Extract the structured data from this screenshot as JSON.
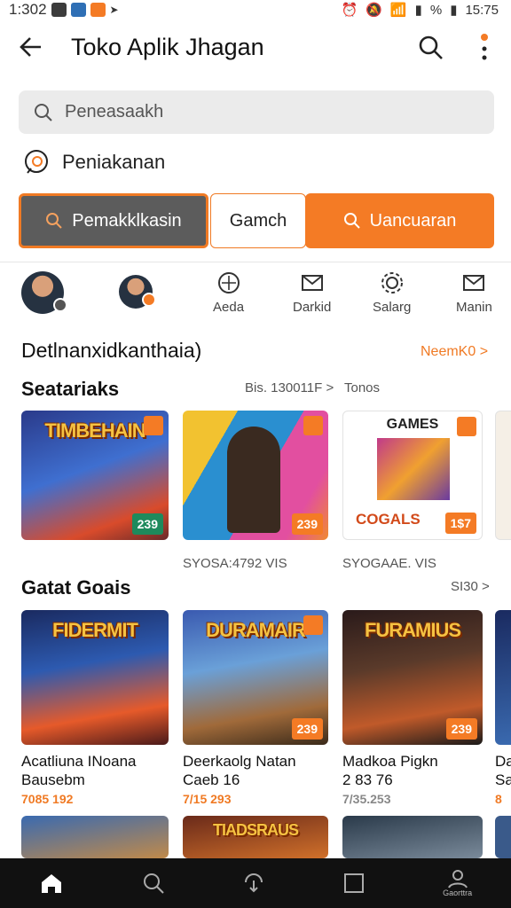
{
  "status": {
    "time": "1:302",
    "time_right": "15:75",
    "battery": "%"
  },
  "appbar": {
    "title": "Toko Aplik Jhagan"
  },
  "search": {
    "placeholder": "Peneasaakh"
  },
  "category": {
    "label": "Peniakanan"
  },
  "pills": [
    {
      "label": "Pemakklkasin"
    },
    {
      "label": "Gamch"
    },
    {
      "label": "Uancuaran"
    }
  ],
  "shortcuts": [
    {
      "label": ""
    },
    {
      "label": ""
    },
    {
      "label": "Aeda"
    },
    {
      "label": "Darkid"
    },
    {
      "label": "Salarg"
    },
    {
      "label": "Manin"
    }
  ],
  "tagline": {
    "text": "Detlnanxidkanthaia)",
    "more": "NeemK0 >"
  },
  "section1": {
    "title": "Seatariaks",
    "meta1": "Bis. 130011F >",
    "meta2": "Tonos",
    "cards": [
      {
        "title": "TIMBEHAIN",
        "price": "239"
      },
      {
        "title": "",
        "price": "239"
      },
      {
        "title": "GAMES",
        "sub": "COGALS",
        "price": "1$7"
      }
    ],
    "foot1": "SYOSA:4792 VIS",
    "foot2": "SYOGAAE. VIS"
  },
  "section2": {
    "title": "Gatat Goais",
    "more": "SI30 >",
    "cards": [
      {
        "art": "FIDERMIT",
        "name": "Acatliuna INoana",
        "sub": "Bausebm",
        "price": "7085 192"
      },
      {
        "art": "DURAMAIR",
        "name": "Deerkaolg Natan",
        "sub": "Caeb 16",
        "price": "7/15 293"
      },
      {
        "art": "FURAMIUS",
        "name": "Madkoa Pigkn",
        "sub": "2 83 76",
        "price": "7/35.253"
      },
      {
        "name": "Da",
        "sub": "Sa",
        "price": "8"
      }
    ]
  },
  "section3": {
    "cards": [
      {
        "art": ""
      },
      {
        "art": "TIADSRAUS"
      },
      {
        "art": ""
      },
      {
        "art": ""
      }
    ]
  },
  "nav": [
    {
      "icon": "home-icon"
    },
    {
      "icon": "search-icon"
    },
    {
      "icon": "update-icon"
    },
    {
      "icon": "square-icon"
    },
    {
      "icon": "profile-icon",
      "label": "Gaorttra"
    }
  ]
}
